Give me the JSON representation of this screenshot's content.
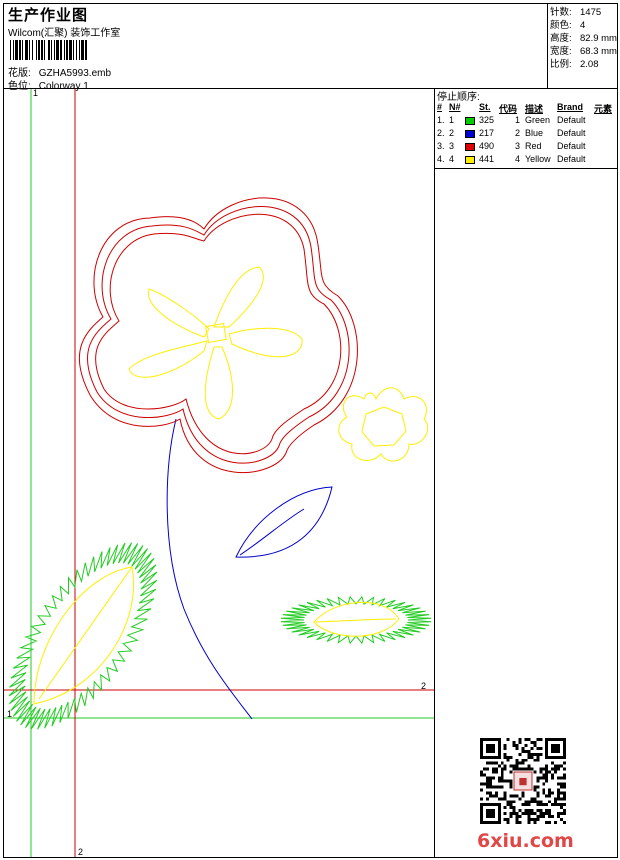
{
  "header": {
    "title": "生产作业图",
    "studio": "Wilcom(汇聚) 装饰工作室",
    "pattern_label": "花版:",
    "pattern_value": "GZHA5993.emb",
    "colorway_label": "色位:",
    "colorway_value": "Colorway 1"
  },
  "stats": [
    {
      "label": "针数:",
      "value": "1475"
    },
    {
      "label": "颜色:",
      "value": "4"
    },
    {
      "label": "高度:",
      "value": "82.9 mm"
    },
    {
      "label": "宽度:",
      "value": "68.3 mm"
    },
    {
      "label": "比例:",
      "value": "2.08"
    }
  ],
  "stop_sequence": {
    "title": "停止顺序:",
    "columns": [
      "#",
      "N#",
      "St.",
      "代码",
      "描述",
      "Brand",
      "元素"
    ],
    "rows": [
      {
        "no": "1.",
        "n": "1",
        "color": "#00cc00",
        "stitches": "325",
        "code": "1",
        "desc": "Green",
        "brand": "Default"
      },
      {
        "no": "2.",
        "n": "2",
        "color": "#0000cc",
        "stitches": "217",
        "code": "2",
        "desc": "Blue",
        "brand": "Default"
      },
      {
        "no": "3.",
        "n": "3",
        "color": "#dd0000",
        "stitches": "490",
        "code": "3",
        "desc": "Red",
        "brand": "Default"
      },
      {
        "no": "4.",
        "n": "4",
        "color": "#ffee00",
        "stitches": "441",
        "code": "4",
        "desc": "Yellow",
        "brand": "Default"
      }
    ]
  },
  "guides": {
    "green_label_top": "1",
    "green_label_left": "1",
    "red_label_right": "2",
    "red_label_bottom": "2"
  },
  "thread_colors": {
    "green": "#22cc22",
    "blue": "#0000cc",
    "red": "#cc0000",
    "yellow": "#ffee00"
  },
  "watermark": "6xiu.com"
}
